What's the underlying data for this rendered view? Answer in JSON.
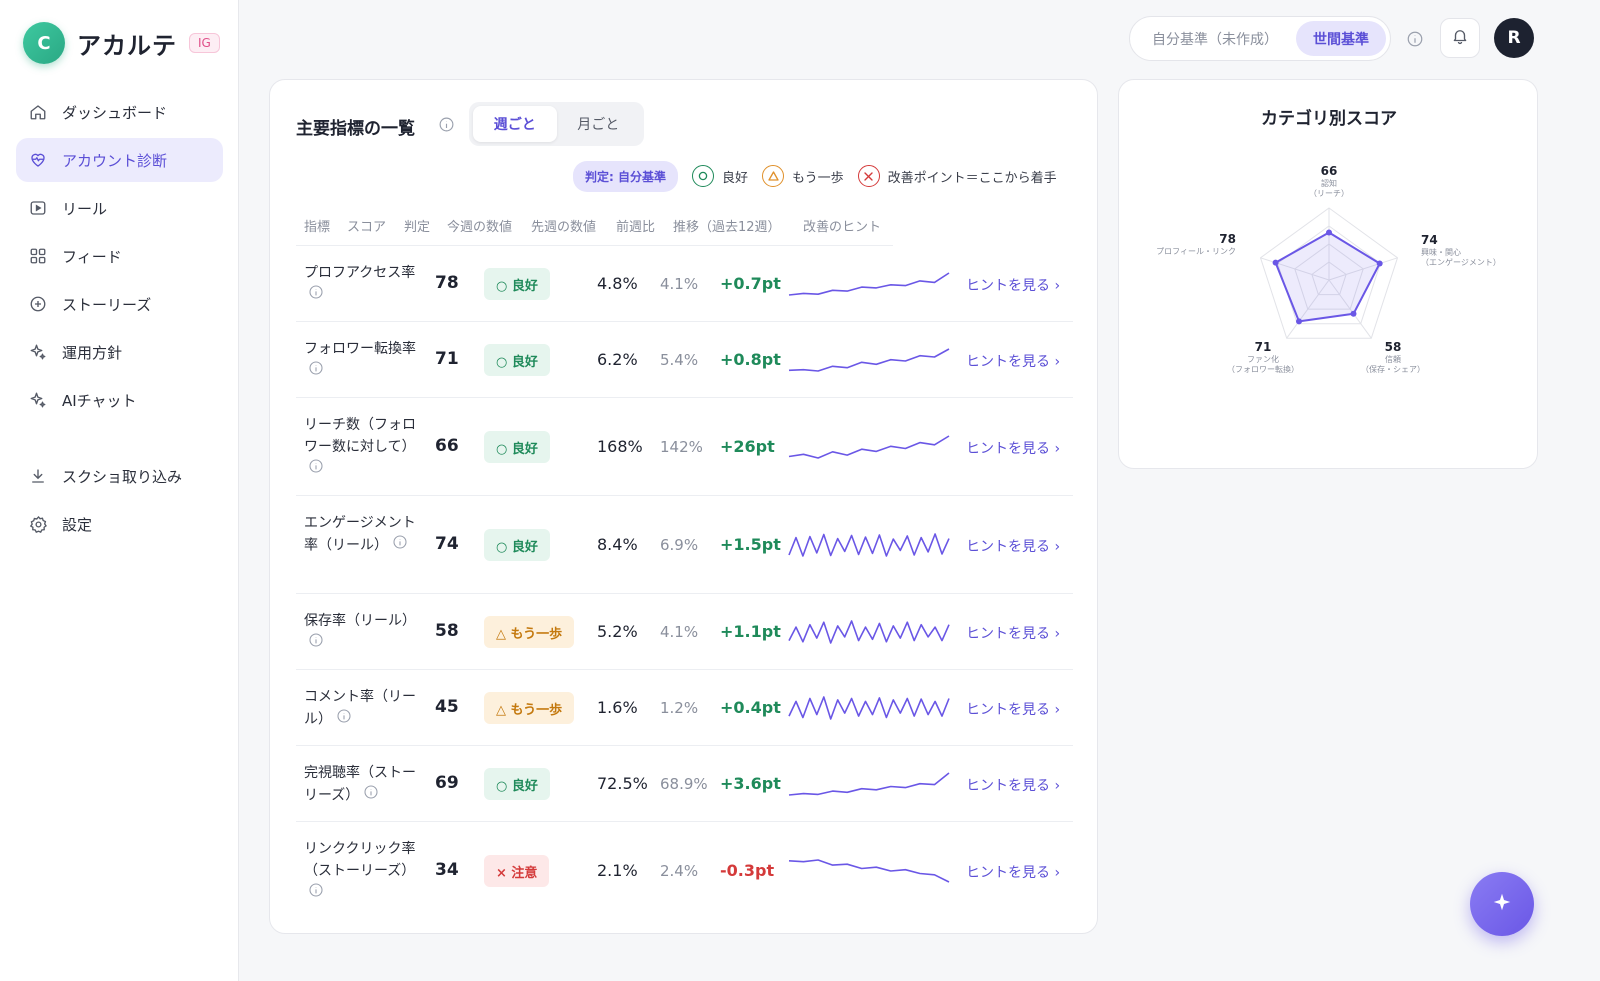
{
  "brand": {
    "logo_letter": "C",
    "name": "アカルテ",
    "badge": "IG"
  },
  "nav": {
    "items": [
      {
        "label": "ダッシュボード",
        "icon": "home-icon",
        "active": false
      },
      {
        "label": "アカウント診断",
        "icon": "heart-pulse-icon",
        "active": true
      },
      {
        "label": "リール",
        "icon": "play-icon",
        "active": false
      },
      {
        "label": "フィード",
        "icon": "grid-icon",
        "active": false
      },
      {
        "label": "ストーリーズ",
        "icon": "plus-circle-icon",
        "active": false
      },
      {
        "label": "運用方針",
        "icon": "sparkle-icon",
        "active": false
      },
      {
        "label": "AIチャット",
        "icon": "sparkle-icon",
        "active": false
      }
    ],
    "bottom_items": [
      {
        "label": "スクショ取り込み",
        "icon": "download-icon"
      },
      {
        "label": "設定",
        "icon": "gear-icon"
      }
    ]
  },
  "header": {
    "toggle_self": "自分基準（未作成）",
    "toggle_world": "世間基準",
    "avatar_initial": "R"
  },
  "main": {
    "title": "主要指標の一覧",
    "tabs": {
      "weekly": "週ごと",
      "monthly": "月ごと"
    },
    "legend": {
      "badge": "判定: 自分基準",
      "good": "良好",
      "mid": "もう一歩",
      "bad": "改善ポイント＝ここから着手"
    },
    "columns": [
      "指標",
      "スコア",
      "判定",
      "今週の数値",
      "先週の数値",
      "前週比",
      "推移（過去12週）",
      "改善のヒント"
    ],
    "hint_label": "ヒントを見る ›",
    "rows": [
      {
        "name": "プロフアクセス率",
        "score": "78",
        "status": "good",
        "badge": "○ 良好",
        "now": "4.8%",
        "prev": "4.1%",
        "delta": "+0.7pt",
        "trend": [
          3.4,
          3.5,
          3.45,
          3.7,
          3.65,
          3.9,
          3.85,
          4.05,
          4.0,
          4.3,
          4.2,
          4.8
        ]
      },
      {
        "name": "フォロワー転換率",
        "score": "71",
        "status": "good",
        "badge": "○ 良好",
        "now": "6.2%",
        "prev": "5.4%",
        "delta": "+0.8pt",
        "trend": [
          4.6,
          4.65,
          4.55,
          4.9,
          4.8,
          5.2,
          5.05,
          5.4,
          5.3,
          5.7,
          5.6,
          6.2
        ]
      },
      {
        "name": "リーチ数（フォロワー数に対して）",
        "score": "66",
        "status": "good",
        "badge": "○ 良好",
        "now": "168%",
        "prev": "142%",
        "delta": "+26pt",
        "trend": [
          112,
          118,
          108,
          125,
          116,
          132,
          126,
          140,
          134,
          150,
          144,
          168
        ]
      },
      {
        "name": "エンゲージメント率（リール）",
        "score": "74",
        "status": "good",
        "badge": "○ 良好",
        "now": "8.4%",
        "prev": "6.9%",
        "delta": "+1.5pt",
        "trend": [
          5.2,
          8.6,
          5.0,
          8.8,
          5.6,
          9.2,
          5.1,
          8.4,
          5.9,
          9.0,
          5.3,
          8.7,
          5.5,
          9.1,
          5.0,
          8.3,
          6.1,
          8.9,
          5.2,
          8.6,
          5.8,
          9.3,
          5.4,
          8.4
        ]
      },
      {
        "name": "保存率（リール）",
        "score": "58",
        "status": "mid",
        "badge": "△ もう一歩",
        "now": "5.2%",
        "prev": "4.1%",
        "delta": "+1.1pt",
        "trend": [
          3.9,
          5.0,
          3.8,
          5.2,
          4.1,
          5.4,
          3.7,
          5.1,
          4.2,
          5.5,
          3.9,
          5.0,
          4.0,
          5.3,
          3.8,
          5.1,
          4.1,
          5.4,
          3.9,
          5.2,
          4.2,
          5.0,
          3.9,
          5.2
        ]
      },
      {
        "name": "コメント率（リール）",
        "score": "45",
        "status": "mid",
        "badge": "△ もう一歩",
        "now": "1.6%",
        "prev": "1.2%",
        "delta": "+0.4pt",
        "trend": [
          1.0,
          1.5,
          0.95,
          1.6,
          1.05,
          1.65,
          0.9,
          1.55,
          1.1,
          1.6,
          1.0,
          1.5,
          1.05,
          1.62,
          0.95,
          1.55,
          1.1,
          1.6,
          1.0,
          1.58,
          1.05,
          1.5,
          1.0,
          1.6
        ]
      },
      {
        "name": "完視聴率（ストーリーズ）",
        "score": "69",
        "status": "good",
        "badge": "○ 良好",
        "now": "72.5%",
        "prev": "68.9%",
        "delta": "+3.6pt",
        "trend": [
          64.5,
          65.0,
          64.7,
          65.9,
          65.5,
          66.8,
          66.4,
          67.6,
          67.2,
          68.6,
          68.3,
          72.5
        ]
      },
      {
        "name": "リンククリック率（ストーリーズ）",
        "score": "34",
        "status": "bad",
        "badge": "× 注意",
        "now": "2.1%",
        "prev": "2.4%",
        "delta": "-0.3pt",
        "trend": [
          2.6,
          2.58,
          2.62,
          2.5,
          2.52,
          2.42,
          2.45,
          2.36,
          2.39,
          2.3,
          2.27,
          2.1
        ]
      }
    ]
  },
  "radar": {
    "title": "カテゴリ別スコア",
    "axes": [
      {
        "value": "66",
        "label": "認知",
        "sub": "（リーチ）"
      },
      {
        "value": "74",
        "label": "興味・関心",
        "sub": "（エンゲージメント）"
      },
      {
        "value": "58",
        "label": "信頼",
        "sub": "（保存・シェア）"
      },
      {
        "value": "71",
        "label": "ファン化",
        "sub": "（フォロワー転換）"
      },
      {
        "value": "78",
        "label": "プロフィール・リンク",
        "sub": ""
      }
    ],
    "accent": "#6a57e6"
  },
  "colors": {
    "accent": "#5b4fd6",
    "good": "#1f8a5a",
    "mid": "#e0902a",
    "bad": "#d43a3a"
  }
}
